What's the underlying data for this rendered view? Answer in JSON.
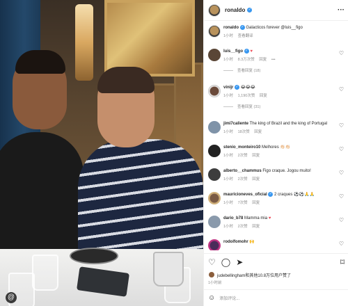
{
  "post": {
    "username": "ronaldo",
    "caption": {
      "username": "ronaldo",
      "text": "Galacticos forever @luis__figo",
      "time": "1小时",
      "translate": "查看翻译"
    },
    "comments": [
      {
        "username": "luis__figo",
        "text": "",
        "emoji": "♥",
        "time": "1小时",
        "likes": "8.3万次赞",
        "reply": "回复",
        "more": "•••",
        "replies": "查看回复 (18)"
      },
      {
        "username": "vinijr",
        "text": "😂😂😂",
        "time": "1小时",
        "likes": "1,190次赞",
        "reply": "回复",
        "replies": "查看回复 (31)"
      },
      {
        "username": "jimi7caliente",
        "text": "The king of Brazil and the king of Portugal",
        "time": "1小时",
        "likes": "18次赞",
        "reply": "回复"
      },
      {
        "username": "stenio_monteiro10",
        "text": "Melhores 👏🏻👏🏻",
        "time": "1小时",
        "likes": "2次赞",
        "reply": "回复"
      },
      {
        "username": "alberto__chammus",
        "text": "Figo craque. Jogou muito!",
        "time": "1小时",
        "likes": "2次赞",
        "reply": "回复"
      },
      {
        "username": "mauricioneves_oficial",
        "text": "2 craques ⚽⚽🙏🙏",
        "time": "1小时",
        "likes": "7次赞",
        "reply": "回复"
      },
      {
        "username": "dario_b78",
        "text": "Mamma mia",
        "emoji": "♥",
        "time": "1小时",
        "likes": "2次赞",
        "reply": "回复"
      },
      {
        "username": "rodolfomohr",
        "text": "🙌",
        "time": "",
        "likes": "",
        "reply": ""
      }
    ],
    "likes_text": "judebellingham和其他10.8万位用户赞了",
    "date": "1小时前",
    "add_comment_placeholder": "添加评论...",
    "photo_tag": "@"
  },
  "icons": {
    "heart": "♡",
    "comment": "◯",
    "share": "➤",
    "save": "⌑",
    "smile": "☺"
  },
  "colors": {
    "verified": "#3897f0",
    "red_heart": "#ed4956",
    "meta_text": "#8e8e8e"
  }
}
